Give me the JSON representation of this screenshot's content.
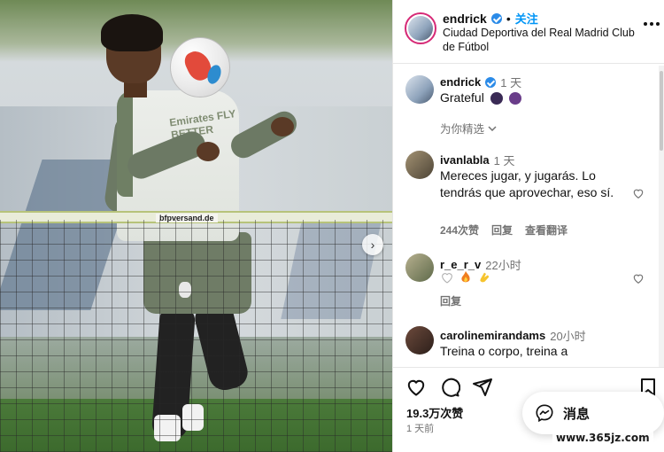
{
  "photo": {
    "net_banner": "bfpversand.de",
    "shirt_sponsor": "Emirates FLY BETTER"
  },
  "post": {
    "username": "endrick",
    "follow_label": "关注",
    "dot": "•",
    "location": "Ciudad Deportiva del Real Madrid Club de Fútbol"
  },
  "caption": {
    "username": "endrick",
    "time": "1 天",
    "text": "Grateful"
  },
  "filter_label": "为你精选",
  "comments": [
    {
      "username": "ivanlabla",
      "time": "1 天",
      "text": "Mereces jugar, y jugarás. Lo tendrás que aprovechar, eso sí.",
      "likes": "244次赞",
      "reply": "回复",
      "translate": "查看翻译"
    },
    {
      "username": "r_e_r_v",
      "time": "22小时",
      "reply": "回复"
    },
    {
      "username": "carolinemirandams",
      "time": "20小时",
      "text": "Treina o corpo, treina a"
    }
  ],
  "actions": {
    "likes": "19.3万次赞",
    "ago": "1 天前"
  },
  "messages": {
    "label": "消息"
  },
  "watermark": "www.365jz.com"
}
